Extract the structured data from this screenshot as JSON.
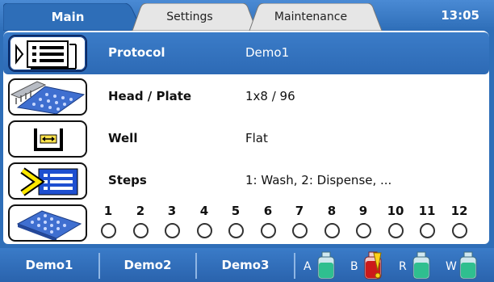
{
  "tabs": [
    {
      "label": "Main",
      "active": true
    },
    {
      "label": "Settings",
      "active": false
    },
    {
      "label": "Maintenance",
      "active": false
    }
  ],
  "clock": "13:05",
  "rows": [
    {
      "label": "Protocol",
      "value": "Demo1",
      "icon": "protocol-icon",
      "selected": true
    },
    {
      "label": "Head / Plate",
      "value": "1x8 / 96",
      "icon": "head-plate-icon"
    },
    {
      "label": "Well",
      "value": "Flat",
      "icon": "well-flat-icon"
    },
    {
      "label": "Steps",
      "value": "1: Wash, 2: Dispense, ...",
      "icon": "steps-icon"
    }
  ],
  "plate_icon": "plate-icon",
  "columns": [
    "1",
    "2",
    "3",
    "4",
    "5",
    "6",
    "7",
    "8",
    "9",
    "10",
    "11",
    "12"
  ],
  "bottom_buttons": [
    "Demo1",
    "Demo2",
    "Demo3"
  ],
  "reservoirs": [
    {
      "letter": "A",
      "color": "#2fbf8f",
      "warning": false
    },
    {
      "letter": "B",
      "color": "#cc1a1a",
      "warning": true
    },
    {
      "letter": "R",
      "color": "#2fbf8f",
      "warning": false
    },
    {
      "letter": "W",
      "color": "#2fbf8f",
      "warning": false
    }
  ],
  "colors": {
    "accent": "#2e6eb8",
    "selected_row": "#3b7cc8",
    "warning": "#ffd21a"
  }
}
